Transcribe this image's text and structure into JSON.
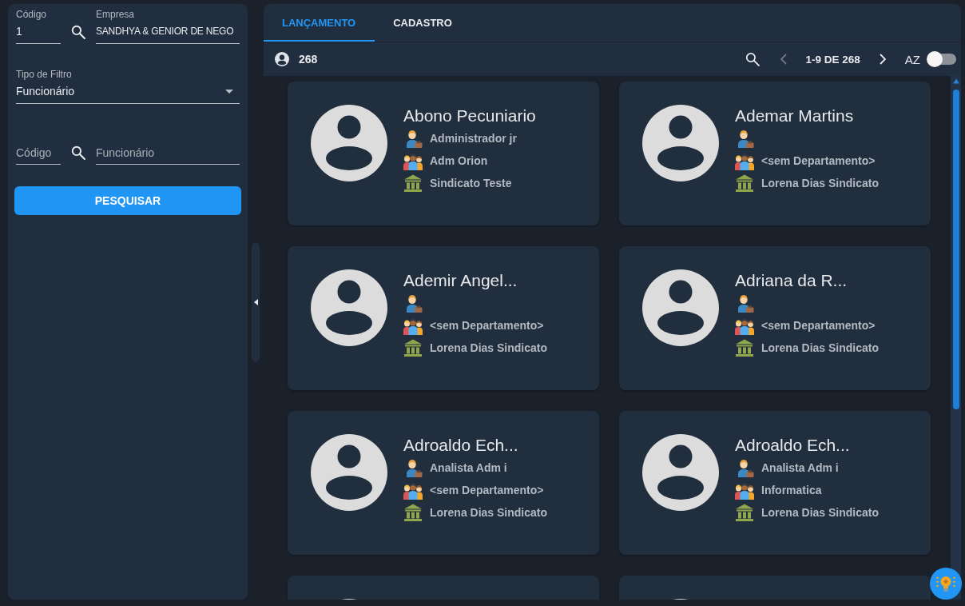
{
  "filters": {
    "company_code": {
      "label": "Código",
      "value": "1"
    },
    "company": {
      "label": "Empresa",
      "value": "SANDHYA & GENIOR DE NEGO"
    },
    "filter_type": {
      "label": "Tipo de Filtro",
      "value": "Funcionário"
    },
    "employee_code": {
      "placeholder": "Código"
    },
    "employee": {
      "placeholder": "Funcionário"
    },
    "search_button": "PESQUISAR"
  },
  "tabs": [
    {
      "label": "LANÇAMENTO",
      "selected": true
    },
    {
      "label": "CADASTRO",
      "selected": false
    }
  ],
  "toolbar": {
    "count": "268",
    "pagination": "1-9 DE 268",
    "previous_page": {
      "disabled": true
    },
    "next_page": {
      "disabled": false
    },
    "sort_button": "AZ",
    "sort_toggle": {
      "on": false
    }
  },
  "cards": [
    {
      "kind": "full",
      "name": "Abono Pecuniario",
      "role": "Administrador jr",
      "department": "Adm Orion",
      "union": "Sindicato Teste"
    },
    {
      "kind": "full",
      "name": "Ademar Martins",
      "department": "<sem Departamento>",
      "union": "Lorena Dias Sindicato"
    },
    {
      "kind": "full",
      "name": "Ademir Angel...",
      "department": "<sem Departamento>",
      "union": "Lorena Dias Sindicato"
    },
    {
      "kind": "full",
      "name": "Adriana da R...",
      "department": "<sem Departamento>",
      "union": "Lorena Dias Sindicato"
    },
    {
      "kind": "full",
      "name": "Adroaldo Ech...",
      "role": "Analista Adm i",
      "department": "<sem Departamento>",
      "union": "Lorena Dias Sindicato"
    },
    {
      "kind": "full",
      "name": "Adroaldo Ech...",
      "role": "Analista Adm i",
      "department": "Informatica",
      "union": "Lorena Dias Sindicato"
    },
    {
      "kind": "clipped"
    },
    {
      "kind": "clipped"
    }
  ]
}
